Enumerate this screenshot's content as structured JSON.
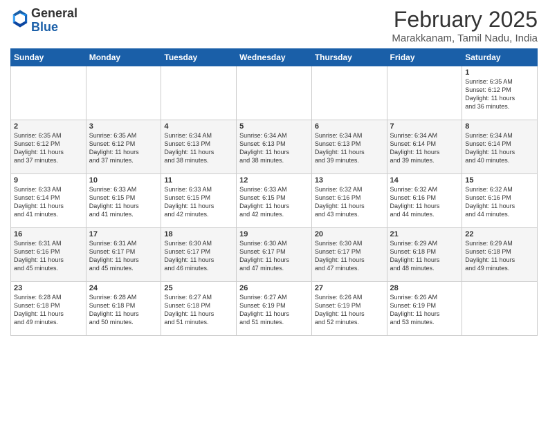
{
  "logo": {
    "general": "General",
    "blue": "Blue"
  },
  "title": "February 2025",
  "subtitle": "Marakkanam, Tamil Nadu, India",
  "headers": [
    "Sunday",
    "Monday",
    "Tuesday",
    "Wednesday",
    "Thursday",
    "Friday",
    "Saturday"
  ],
  "weeks": [
    [
      {
        "day": "",
        "info": ""
      },
      {
        "day": "",
        "info": ""
      },
      {
        "day": "",
        "info": ""
      },
      {
        "day": "",
        "info": ""
      },
      {
        "day": "",
        "info": ""
      },
      {
        "day": "",
        "info": ""
      },
      {
        "day": "1",
        "info": "Sunrise: 6:35 AM\nSunset: 6:12 PM\nDaylight: 11 hours\nand 36 minutes."
      }
    ],
    [
      {
        "day": "2",
        "info": "Sunrise: 6:35 AM\nSunset: 6:12 PM\nDaylight: 11 hours\nand 37 minutes."
      },
      {
        "day": "3",
        "info": "Sunrise: 6:35 AM\nSunset: 6:12 PM\nDaylight: 11 hours\nand 37 minutes."
      },
      {
        "day": "4",
        "info": "Sunrise: 6:34 AM\nSunset: 6:13 PM\nDaylight: 11 hours\nand 38 minutes."
      },
      {
        "day": "5",
        "info": "Sunrise: 6:34 AM\nSunset: 6:13 PM\nDaylight: 11 hours\nand 38 minutes."
      },
      {
        "day": "6",
        "info": "Sunrise: 6:34 AM\nSunset: 6:13 PM\nDaylight: 11 hours\nand 39 minutes."
      },
      {
        "day": "7",
        "info": "Sunrise: 6:34 AM\nSunset: 6:14 PM\nDaylight: 11 hours\nand 39 minutes."
      },
      {
        "day": "8",
        "info": "Sunrise: 6:34 AM\nSunset: 6:14 PM\nDaylight: 11 hours\nand 40 minutes."
      }
    ],
    [
      {
        "day": "9",
        "info": "Sunrise: 6:33 AM\nSunset: 6:14 PM\nDaylight: 11 hours\nand 41 minutes."
      },
      {
        "day": "10",
        "info": "Sunrise: 6:33 AM\nSunset: 6:15 PM\nDaylight: 11 hours\nand 41 minutes."
      },
      {
        "day": "11",
        "info": "Sunrise: 6:33 AM\nSunset: 6:15 PM\nDaylight: 11 hours\nand 42 minutes."
      },
      {
        "day": "12",
        "info": "Sunrise: 6:33 AM\nSunset: 6:15 PM\nDaylight: 11 hours\nand 42 minutes."
      },
      {
        "day": "13",
        "info": "Sunrise: 6:32 AM\nSunset: 6:16 PM\nDaylight: 11 hours\nand 43 minutes."
      },
      {
        "day": "14",
        "info": "Sunrise: 6:32 AM\nSunset: 6:16 PM\nDaylight: 11 hours\nand 44 minutes."
      },
      {
        "day": "15",
        "info": "Sunrise: 6:32 AM\nSunset: 6:16 PM\nDaylight: 11 hours\nand 44 minutes."
      }
    ],
    [
      {
        "day": "16",
        "info": "Sunrise: 6:31 AM\nSunset: 6:16 PM\nDaylight: 11 hours\nand 45 minutes."
      },
      {
        "day": "17",
        "info": "Sunrise: 6:31 AM\nSunset: 6:17 PM\nDaylight: 11 hours\nand 45 minutes."
      },
      {
        "day": "18",
        "info": "Sunrise: 6:30 AM\nSunset: 6:17 PM\nDaylight: 11 hours\nand 46 minutes."
      },
      {
        "day": "19",
        "info": "Sunrise: 6:30 AM\nSunset: 6:17 PM\nDaylight: 11 hours\nand 47 minutes."
      },
      {
        "day": "20",
        "info": "Sunrise: 6:30 AM\nSunset: 6:17 PM\nDaylight: 11 hours\nand 47 minutes."
      },
      {
        "day": "21",
        "info": "Sunrise: 6:29 AM\nSunset: 6:18 PM\nDaylight: 11 hours\nand 48 minutes."
      },
      {
        "day": "22",
        "info": "Sunrise: 6:29 AM\nSunset: 6:18 PM\nDaylight: 11 hours\nand 49 minutes."
      }
    ],
    [
      {
        "day": "23",
        "info": "Sunrise: 6:28 AM\nSunset: 6:18 PM\nDaylight: 11 hours\nand 49 minutes."
      },
      {
        "day": "24",
        "info": "Sunrise: 6:28 AM\nSunset: 6:18 PM\nDaylight: 11 hours\nand 50 minutes."
      },
      {
        "day": "25",
        "info": "Sunrise: 6:27 AM\nSunset: 6:18 PM\nDaylight: 11 hours\nand 51 minutes."
      },
      {
        "day": "26",
        "info": "Sunrise: 6:27 AM\nSunset: 6:19 PM\nDaylight: 11 hours\nand 51 minutes."
      },
      {
        "day": "27",
        "info": "Sunrise: 6:26 AM\nSunset: 6:19 PM\nDaylight: 11 hours\nand 52 minutes."
      },
      {
        "day": "28",
        "info": "Sunrise: 6:26 AM\nSunset: 6:19 PM\nDaylight: 11 hours\nand 53 minutes."
      },
      {
        "day": "",
        "info": ""
      }
    ]
  ]
}
